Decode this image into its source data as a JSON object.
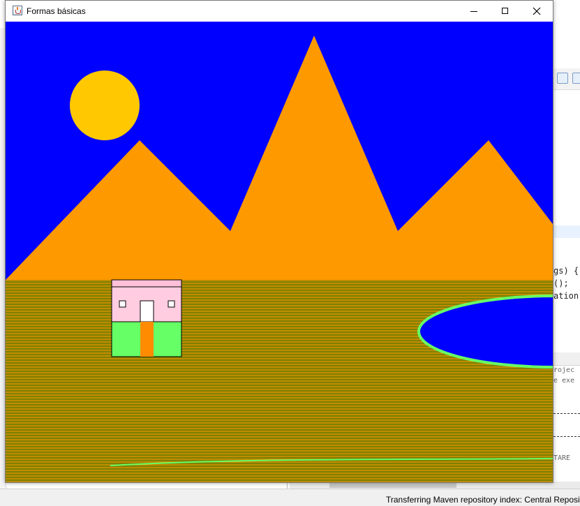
{
  "window": {
    "title": "Formas básicas",
    "app_icon": "java-cup-icon",
    "controls": [
      "minimize-icon",
      "maximize-icon",
      "close-icon"
    ]
  },
  "scene": {
    "colors": {
      "sky": "#0000ff",
      "sun": "#ffc800",
      "mountains": "#ff9900",
      "ground": "#808000",
      "ground_stripe": "#ff9900",
      "house_roof": "#ffc0d8",
      "house_wall": "#ffcce0",
      "house_base": "#66ff66",
      "house_door": "#ff8c00",
      "lake": "#0000ff",
      "lake_border": "#66ff66",
      "grass_line": "#66ff66"
    }
  },
  "ide": {
    "code_lines": [
      "gs) {",
      "();",
      "ation"
    ],
    "output_lines": [
      "rojec",
      "e exe",
      "TARE"
    ],
    "status_text": "Transferring Maven repository index: Central Repository"
  }
}
